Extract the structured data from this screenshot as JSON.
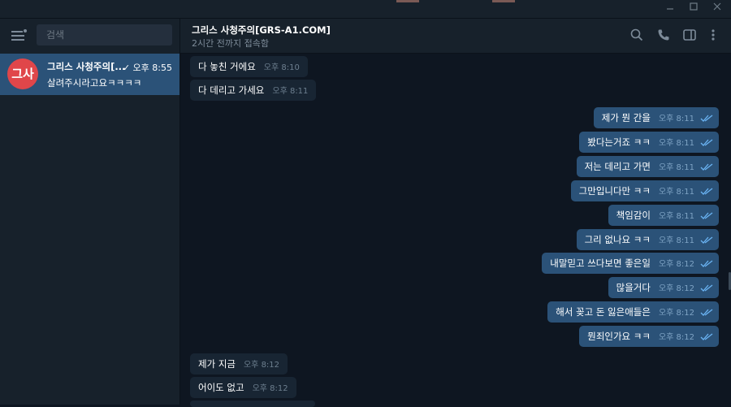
{
  "sidebar": {
    "search_placeholder": "검색",
    "chats": [
      {
        "avatar": "그사",
        "name": "그리스 사청주의[...",
        "time": "✓ 오후 8:55",
        "preview": "살려주시라고요ㅋㅋㅋㅋ",
        "avatar_color": "#e0464a"
      }
    ]
  },
  "header": {
    "title": "그리스 사청주의[GRS-A1.COM]",
    "status": "2시간 전까지 접속함"
  },
  "icons": {
    "search": "search-icon",
    "call": "phone-icon",
    "panel": "sidebar-toggle-icon",
    "more": "more-vertical-icon"
  },
  "messages": [
    {
      "dir": "in",
      "text": "다 놓친 거에요",
      "time": "오후 8:10"
    },
    {
      "dir": "in",
      "text": "다 데리고 가세요",
      "time": "오후 8:11"
    },
    {
      "dir": "out",
      "text": "제가 뭔 간을",
      "time": "오후 8:11",
      "read": true
    },
    {
      "dir": "out",
      "text": "봤다는거죠 ㅋㅋ",
      "time": "오후 8:11",
      "read": true
    },
    {
      "dir": "out",
      "text": "저는 데리고 가면",
      "time": "오후 8:11",
      "read": true
    },
    {
      "dir": "out",
      "text": "그만입니다만 ㅋㅋ",
      "time": "오후 8:11",
      "read": true
    },
    {
      "dir": "out",
      "text": "책임감이",
      "time": "오후 8:11",
      "read": true
    },
    {
      "dir": "out",
      "text": "그리 없나요 ㅋㅋ",
      "time": "오후 8:11",
      "read": true
    },
    {
      "dir": "out",
      "text": "내말믿고 쓰다보면 좋은일",
      "time": "오후 8:12",
      "read": true
    },
    {
      "dir": "out",
      "text": "많을거다",
      "time": "오후 8:12",
      "read": true
    },
    {
      "dir": "out",
      "text": "해서 꽂고 돈 잃은애들은",
      "time": "오후 8:12",
      "read": true
    },
    {
      "dir": "out",
      "text": "뭔죄인가요 ㅋㅋ",
      "time": "오후 8:12",
      "read": true
    },
    {
      "dir": "in",
      "text": "제가 지금",
      "time": "오후 8:12"
    },
    {
      "dir": "in",
      "text": "어이도 없고",
      "time": "오후 8:12"
    }
  ],
  "colors": {
    "background": "#0e1621",
    "sidebar": "#17212b",
    "active_chat": "#2b5278",
    "incoming_bubble": "#182533",
    "outgoing_bubble": "#2b5278",
    "read_ticks": "#6ab3f3"
  }
}
